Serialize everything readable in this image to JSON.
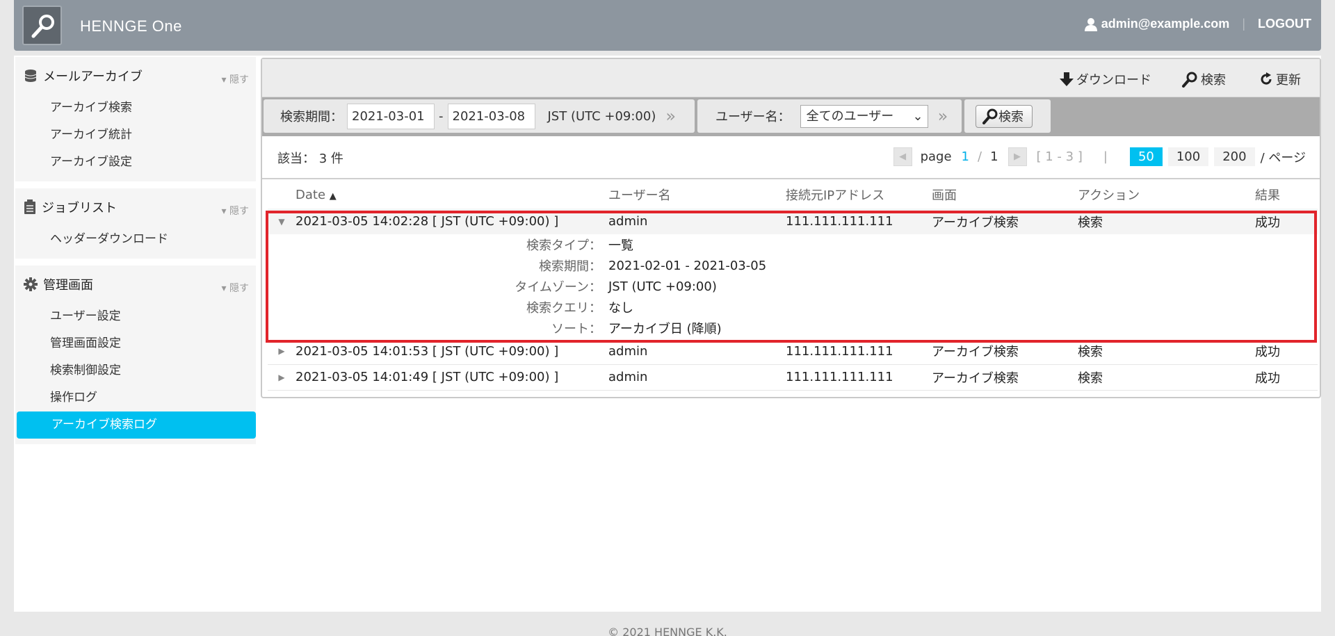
{
  "header": {
    "brand": "HENNGE One",
    "user_email": "admin@example.com",
    "logout": "LOGOUT"
  },
  "sidebar": {
    "sections": [
      {
        "title": "メールアーカイブ",
        "hide": "隠す",
        "items": [
          "アーカイブ検索",
          "アーカイブ統計",
          "アーカイブ設定"
        ]
      },
      {
        "title": "ジョブリスト",
        "hide": "隠す",
        "items": [
          "ヘッダーダウンロード"
        ]
      },
      {
        "title": "管理画面",
        "hide": "隠す",
        "items": [
          "ユーザー設定",
          "管理画面設定",
          "検索制御設定",
          "操作ログ",
          "アーカイブ検索ログ"
        ]
      }
    ],
    "active_item": "アーカイブ検索ログ"
  },
  "toolbar": {
    "download": "ダウンロード",
    "search": "検索",
    "refresh": "更新"
  },
  "filter": {
    "period_label": "検索期間：",
    "date_from": "2021-03-01",
    "date_sep": "-",
    "date_to": "2021-03-08",
    "timezone": "JST (UTC +09:00)",
    "user_label": "ユーザー名：",
    "user_value": "全てのユーザー",
    "search_button": "検索"
  },
  "results": {
    "count_label": "該当： 3 件",
    "page_label": "page",
    "page_current": "1",
    "page_sep": "/",
    "page_total": "1",
    "range": "[ 1 - 3 ]",
    "page_sizes": [
      "50",
      "100",
      "200"
    ],
    "page_size_selected": "50",
    "page_suffix": "/ ページ"
  },
  "table": {
    "headers": [
      "Date",
      "ユーザー名",
      "接続元IPアドレス",
      "画面",
      "アクション",
      "結果"
    ],
    "rows": [
      {
        "date": "2021-03-05 14:02:28 [ JST (UTC +09:00) ]",
        "user": "admin",
        "ip": "111.111.111.111",
        "screen": "アーカイブ検索",
        "action": "検索",
        "result": "成功"
      },
      {
        "date": "2021-03-05 14:01:53 [ JST (UTC +09:00) ]",
        "user": "admin",
        "ip": "111.111.111.111",
        "screen": "アーカイブ検索",
        "action": "検索",
        "result": "成功"
      },
      {
        "date": "2021-03-05 14:01:49 [ JST (UTC +09:00) ]",
        "user": "admin",
        "ip": "111.111.111.111",
        "screen": "アーカイブ検索",
        "action": "検索",
        "result": "成功"
      }
    ],
    "details": [
      {
        "label": "検索タイプ：",
        "value": "一覧"
      },
      {
        "label": "検索期間：",
        "value": "2021-02-01 - 2021-03-05"
      },
      {
        "label": "タイムゾーン：",
        "value": "JST (UTC +09:00)"
      },
      {
        "label": "検索クエリ：",
        "value": "なし"
      },
      {
        "label": "ソート：",
        "value": "アーカイブ日 (降順)"
      }
    ]
  },
  "footer": "© 2021 HENNGE K.K.",
  "colors": {
    "accent": "#00c0f0",
    "highlight": "#e1242b",
    "header": "#8d969f"
  }
}
